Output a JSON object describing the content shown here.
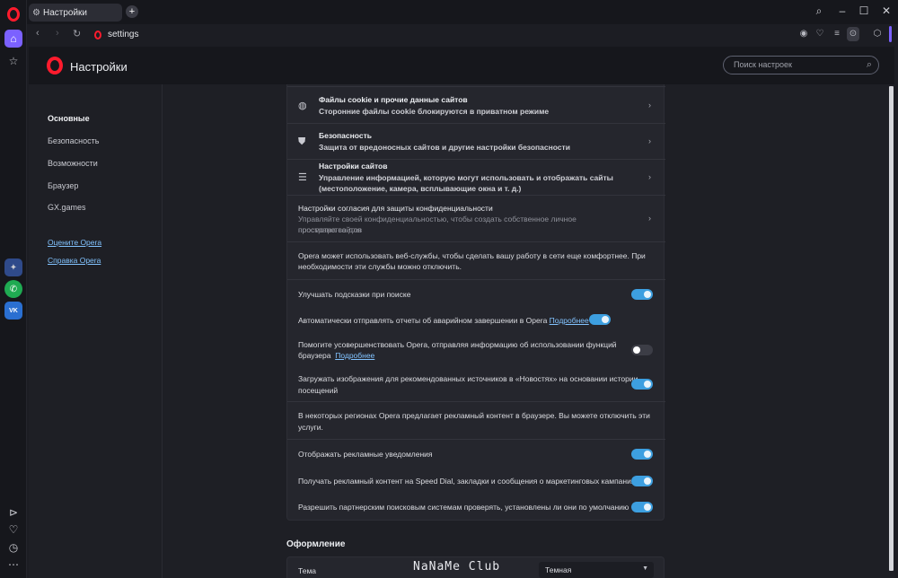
{
  "browser": {
    "tab_title": "Настройки",
    "new_tab_icon": "+",
    "url": "settings",
    "window_controls": [
      "search-icon",
      "minimize-icon",
      "maximize-icon",
      "close-icon"
    ]
  },
  "sidebar": {
    "top_icons": [
      "opera-logo",
      "home-icon",
      "star-icon"
    ],
    "messenger_icons": [
      "aria-icon",
      "whatsapp-icon",
      "vk-icon"
    ],
    "bottom_icons": [
      "player-icon",
      "heart-icon",
      "history-icon",
      "more-icon"
    ],
    "vk_label": "VK"
  },
  "header": {
    "title": "Настройки",
    "search_placeholder": "Поиск настроек"
  },
  "leftnav": {
    "items": [
      "Основные",
      "Безопасность",
      "Возможности",
      "Браузер",
      "GX.games"
    ],
    "links": [
      "Оцените Opera",
      "Справка Opera"
    ]
  },
  "privacy": {
    "cookies_title": "Файлы cookie и прочие данные сайтов",
    "cookies_sub": "Сторонние файлы cookie блокируются в приватном режиме",
    "security_title": "Безопасность",
    "security_sub": "Защита от вредоносных сайтов и другие настройки безопасности",
    "site_settings_title": "Настройки сайтов",
    "site_settings_sub1": "Управление информацией, которую могут использовать и отображать сайты",
    "site_settings_sub2": "(местоположение, камера, всплывающие окна и т. д.)",
    "consent_title": "Настройки согласия для защиты конфиденциальности",
    "consent_sub1": "Управляйте своей конфиденциальностью, чтобы создать собственное личное пространство для",
    "consent_sub2": "просмотра сайтов",
    "webservices_text1": "Opera может использовать веб-службы, чтобы сделать вашу работу в сети еще комфортнее. При",
    "webservices_text2": "необходимости эти службы можно отключить.",
    "toggles": {
      "suggestions": {
        "label": "Улучшать подсказки при поиске",
        "on": true
      },
      "crash_reports": {
        "label": "Автоматически отправлять отчеты об аварийном завершении в Opera",
        "link": "Подробнее",
        "on": true
      },
      "usage_info": {
        "label1": "Помогите усовершенствовать Opera, отправляя информацию об использовании функций",
        "label2": "браузера",
        "link": "Подробнее",
        "on": false
      },
      "news_images": {
        "label1": "Загружать изображения для рекомендованных источников в «Новостях» на основании истории",
        "label2": "посещений",
        "on": true
      }
    },
    "ads_text1": "В некоторых регионах Opera предлагает рекламный контент в браузере. Вы можете отключить эти",
    "ads_text2": "услуги.",
    "ad_toggles": {
      "ad_notifications": {
        "label": "Отображать рекламные уведомления",
        "on": true
      },
      "speed_dial_ads": {
        "label": "Получать рекламный контент на Speed Dial, закладки и сообщения о маркетинговых кампаниях",
        "on": true
      },
      "partner_search": {
        "label": "Разрешить партнерским поисковым системам проверять, установлены ли они по умолчанию",
        "on": true
      }
    }
  },
  "appearance": {
    "section_title": "Оформление",
    "theme_label": "Тема",
    "theme_value": "Темная"
  },
  "watermark": "NaNaMe Club",
  "colors": {
    "accent": "#3d9fe0",
    "opera_red": "#ff1b2d",
    "link": "#82c3ff"
  }
}
